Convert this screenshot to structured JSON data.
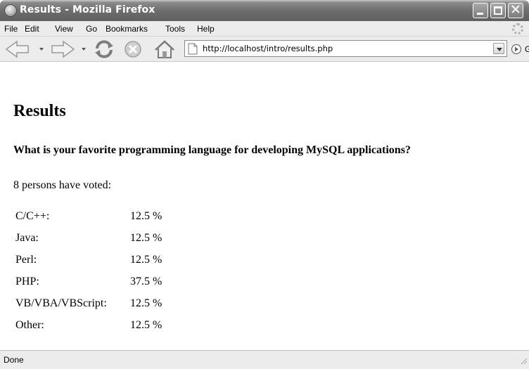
{
  "window": {
    "title": "Results - Mozilla Firefox"
  },
  "menubar": {
    "items": [
      {
        "label": "File"
      },
      {
        "label": "Edit"
      },
      {
        "label": "View"
      },
      {
        "label": "Go"
      },
      {
        "label": "Bookmarks"
      },
      {
        "label": "Tools"
      },
      {
        "label": "Help"
      }
    ]
  },
  "navbar": {
    "url": "http://localhost/intro/results.php",
    "go_label": "Go"
  },
  "page": {
    "heading": "Results",
    "question": "What is your favorite programming language for developing MySQL applications?",
    "vote_summary": "8 persons have voted:",
    "results": [
      {
        "language": "C/C++:",
        "percent": "12.5 %"
      },
      {
        "language": "Java:",
        "percent": "12.5 %"
      },
      {
        "language": "Perl:",
        "percent": "12.5 %"
      },
      {
        "language": "PHP:",
        "percent": "37.5 %"
      },
      {
        "language": "VB/VBA/VBScript:",
        "percent": "12.5 %"
      },
      {
        "language": "Other:",
        "percent": "12.5 %"
      }
    ]
  },
  "statusbar": {
    "text": "Done"
  },
  "colors": {
    "titlebar": "#6e6e6e",
    "chrome": "#ececec"
  }
}
